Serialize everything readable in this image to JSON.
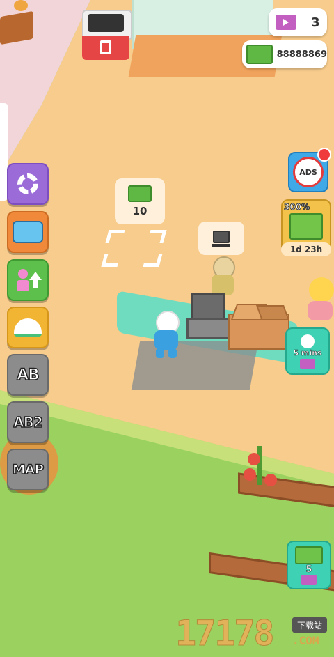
{
  "hud": {
    "tickets": "3",
    "cash": "88888869"
  },
  "sidebar": {
    "ab_label": "AB",
    "ab2_label": "AB2",
    "map_label": "MAP"
  },
  "right_panel": {
    "ads_label": "ADS",
    "boost_percent": "300%",
    "boost_timer": "1d 23h",
    "speed_timer": "5 mins",
    "stack_count": "5"
  },
  "world": {
    "upgrade_cost": "10"
  },
  "watermark": {
    "digits": "17178",
    "site_cn": "下载站",
    "site_domain": ".COM"
  },
  "colors": {
    "floor": "#f7cc8d",
    "grass": "#9ad15f",
    "counter": "#6fdcc0",
    "accent_pink": "#e25aa8"
  }
}
